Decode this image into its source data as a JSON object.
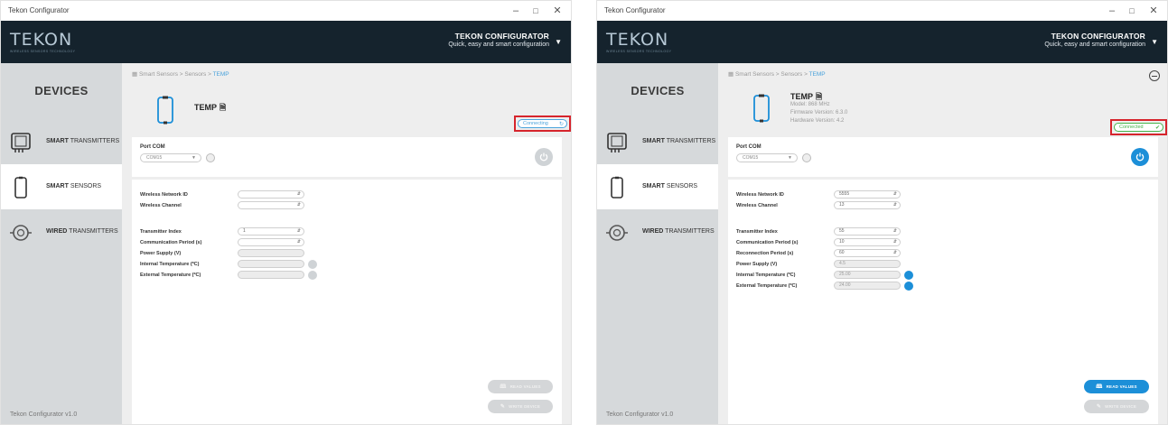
{
  "left": {
    "title": "Tekon Configurator",
    "logo": {
      "word": "TEKON",
      "tagline": "WIRELESS SENSORS TECHNOLOGY"
    },
    "header": {
      "title": "TEKON CONFIGURATOR",
      "subtitle": "Quick, easy and smart configuration"
    },
    "sidebar": {
      "title": "DEVICES",
      "items": [
        {
          "bold": "SMART",
          "rest": "TRANSMITTERS"
        },
        {
          "bold": "SMART",
          "rest": "SENSORS"
        },
        {
          "bold": "WIRED",
          "rest": "TRANSMITTERS"
        }
      ],
      "version": "Tekon Configurator v1.0"
    },
    "breadcrumb": {
      "part1": "Smart Sensors",
      "sep": ">",
      "part2": "Sensors",
      "current": "TEMP"
    },
    "device": {
      "name": "TEMP"
    },
    "status": {
      "label": "Connecting",
      "icon": "spinner-icon"
    },
    "port": {
      "label": "Port COM",
      "value": "COM15"
    },
    "fields": [
      {
        "label": "Wireless Network ID",
        "value": ""
      },
      {
        "label": "Wireless Channel",
        "value": ""
      },
      {
        "label": "Transmitter Index",
        "value": "1"
      },
      {
        "label": "Communication Period (s)",
        "value": ""
      },
      {
        "label": "Power Supply (V)",
        "value": ""
      },
      {
        "label": "Internal Temperature (ºC)",
        "value": ""
      },
      {
        "label": "External Temperature (ºC)",
        "value": ""
      }
    ],
    "buttons": {
      "read": "READ VALUES",
      "write": "WRITE DEVICE"
    }
  },
  "right": {
    "title": "Tekon Configurator",
    "logo": {
      "word": "TEKON",
      "tagline": "WIRELESS SENSORS TECHNOLOGY"
    },
    "header": {
      "title": "TEKON CONFIGURATOR",
      "subtitle": "Quick, easy and smart configuration"
    },
    "sidebar": {
      "title": "DEVICES",
      "items": [
        {
          "bold": "SMART",
          "rest": "TRANSMITTERS"
        },
        {
          "bold": "SMART",
          "rest": "SENSORS"
        },
        {
          "bold": "WIRED",
          "rest": "TRANSMITTERS"
        }
      ],
      "version": "Tekon Configurator v1.0"
    },
    "breadcrumb": {
      "part1": "Smart Sensors",
      "sep": ">",
      "part2": "Sensors",
      "current": "TEMP"
    },
    "device": {
      "name": "TEMP",
      "model": "Model: 868 MHz",
      "firmware": "Firmware Version: 6.3.0",
      "hardware": "Hardware Version: 4.2"
    },
    "status": {
      "label": "Connected",
      "icon": "check-circle-icon"
    },
    "port": {
      "label": "Port COM",
      "value": "COM15"
    },
    "fields": [
      {
        "label": "Wireless Network ID",
        "value": "5555"
      },
      {
        "label": "Wireless Channel",
        "value": "13"
      },
      {
        "label": "Transmitter Index",
        "value": "55"
      },
      {
        "label": "Communication Period (s)",
        "value": "10"
      },
      {
        "label": "Reconnection Period (s)",
        "value": "60"
      },
      {
        "label": "Power Supply (V)",
        "value": "4.5"
      },
      {
        "label": "Internal Temperature (ºC)",
        "value": "25.00"
      },
      {
        "label": "External Temperature (ºC)",
        "value": "24.00"
      }
    ],
    "buttons": {
      "read": "READ VALUES",
      "write": "WRITE DEVICE"
    }
  },
  "colors": {
    "header": "#15232d",
    "sidebar": "#d6d9db",
    "accent": "#1c8fd8",
    "connected": "#45b24a",
    "highlight": "#d6242c"
  }
}
